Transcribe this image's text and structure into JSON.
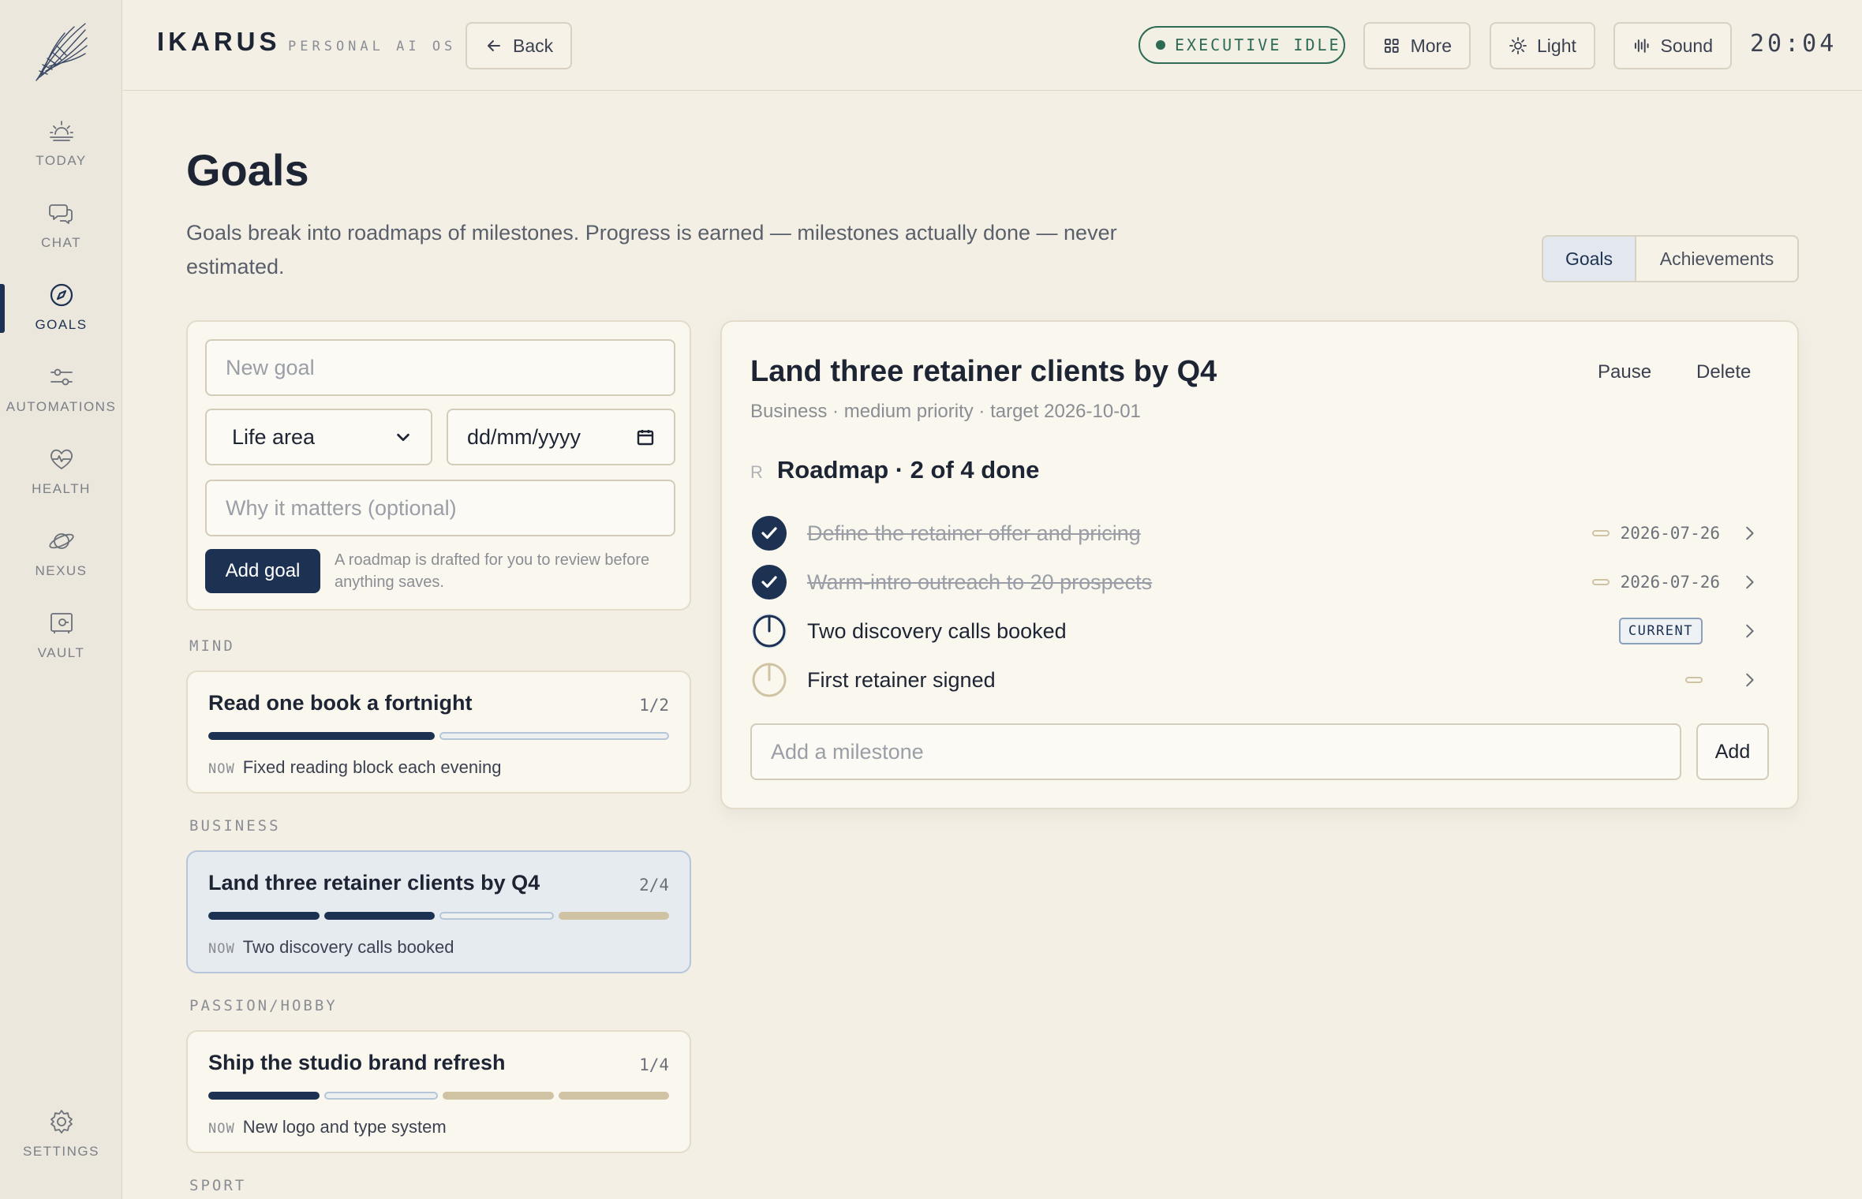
{
  "sidebar": {
    "items": [
      {
        "label": "TODAY",
        "icon": "sunrise-icon"
      },
      {
        "label": "CHAT",
        "icon": "chat-bubbles-icon"
      },
      {
        "label": "GOALS",
        "icon": "compass-icon",
        "active": true
      },
      {
        "label": "AUTOMATIONS",
        "icon": "sliders-icon"
      },
      {
        "label": "HEALTH",
        "icon": "heart-pulse-icon"
      },
      {
        "label": "NEXUS",
        "icon": "planet-icon"
      },
      {
        "label": "VAULT",
        "icon": "safe-icon"
      }
    ],
    "settings_label": "SETTINGS"
  },
  "header": {
    "brand": "IKARUS",
    "brand_sub": "PERSONAL AI OS",
    "back_label": "Back",
    "status": "EXECUTIVE IDLE",
    "more_label": "More",
    "theme_label": "Light",
    "sound_label": "Sound",
    "clock": "20:04"
  },
  "page": {
    "title": "Goals",
    "description": "Goals break into roadmaps of milestones. Progress is earned — milestones actually done — never estimated.",
    "tabs": {
      "goals": "Goals",
      "achievements": "Achievements"
    }
  },
  "form": {
    "new_goal_placeholder": "New goal",
    "life_area": "Life area",
    "date_placeholder": "dd/mm/yyyy",
    "why_placeholder": "Why it matters (optional)",
    "add_goal_label": "Add goal",
    "hint": "A roadmap is drafted for you to review before anything saves."
  },
  "categories": {
    "mind": "MIND",
    "business": "BUSINESS",
    "passion": "PASSION/HOBBY",
    "sport": "SPORT"
  },
  "goals": [
    {
      "title": "Read one book a fortnight",
      "count": "1/2",
      "now_tag": "NOW",
      "now": "Fixed reading block each evening",
      "bars": [
        "done",
        "current"
      ]
    },
    {
      "title": "Land three retainer clients by Q4",
      "count": "2/4",
      "now_tag": "NOW",
      "now": "Two discovery calls booked",
      "bars": [
        "done",
        "done",
        "current",
        "pending"
      ]
    },
    {
      "title": "Ship the studio brand refresh",
      "count": "1/4",
      "now_tag": "NOW",
      "now": "New logo and type system",
      "bars": [
        "done",
        "current",
        "pending",
        "pending"
      ]
    }
  ],
  "detail": {
    "title": "Land three retainer clients by Q4",
    "meta": "Business · medium priority · target 2026-10-01",
    "pause_label": "Pause",
    "delete_label": "Delete",
    "roadmap_letter": "R",
    "roadmap_title": "Roadmap · 2 of 4 done",
    "milestones": [
      {
        "text": "Define the retainer offer and pricing",
        "state": "done",
        "date": "2026-07-26"
      },
      {
        "text": "Warm-intro outreach to 20 prospects",
        "state": "done",
        "date": "2026-07-26"
      },
      {
        "text": "Two discovery calls booked",
        "state": "current",
        "badge": "CURRENT"
      },
      {
        "text": "First retainer signed",
        "state": "pending"
      }
    ],
    "milestone_placeholder": "Add a milestone",
    "add_label": "Add"
  },
  "colors": {
    "navy": "#1d3253",
    "green": "#2e6b55",
    "background": "#f3efe5",
    "sand": "#cfc3a4"
  }
}
